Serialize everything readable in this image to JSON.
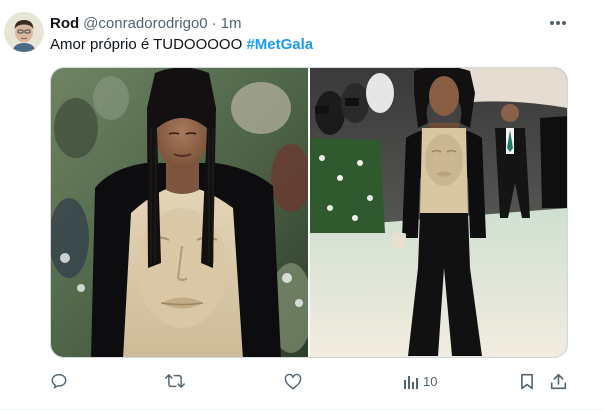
{
  "tweet": {
    "display_name": "Rod",
    "handle": "@conradorodrigo0",
    "separator": "·",
    "time": "1m",
    "text_prefix": "Amor próprio é TUDOOOOO ",
    "hashtag": "#MetGala"
  },
  "media": {
    "photos": [
      {
        "name": "photo-1"
      },
      {
        "name": "photo-2"
      }
    ]
  },
  "actions": {
    "reply_icon": "reply-icon",
    "retweet_icon": "retweet-icon",
    "like_icon": "heart-icon",
    "views_icon": "views-chart-icon",
    "views_count": "10",
    "bookmark_icon": "bookmark-icon",
    "share_icon": "share-icon"
  },
  "colors": {
    "accent": "#1d9bf0",
    "secondary_text": "#536471",
    "primary_text": "#0f1419"
  }
}
